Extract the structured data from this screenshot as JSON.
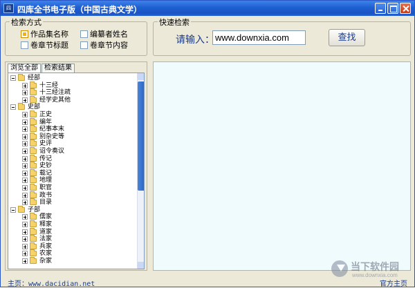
{
  "window": {
    "title": "四库全书电子版（中国古典文学）",
    "icon_name": "app-icon",
    "accent": "#2359d0"
  },
  "search_mode": {
    "legend": "检索方式",
    "options": [
      {
        "label": "作品集名称",
        "checked": true
      },
      {
        "label": "编纂者姓名",
        "checked": false
      },
      {
        "label": "卷章节标题",
        "checked": false
      },
      {
        "label": "卷章节内容",
        "checked": false
      }
    ]
  },
  "quick_search": {
    "legend": "快速检索",
    "label": "请输入：",
    "value": "www.downxia.com",
    "button": "查找"
  },
  "tabs": [
    {
      "label": "浏览全部",
      "active": true
    },
    {
      "label": "检索结果",
      "active": false
    }
  ],
  "tree": [
    {
      "label": "经部",
      "level": 0,
      "expanded": true
    },
    {
      "label": "十三经",
      "level": 1
    },
    {
      "label": "十三经注疏",
      "level": 1
    },
    {
      "label": "经学史其他",
      "level": 1
    },
    {
      "label": "史部",
      "level": 0,
      "expanded": true
    },
    {
      "label": "正史",
      "level": 1
    },
    {
      "label": "编年",
      "level": 1
    },
    {
      "label": "纪事本末",
      "level": 1
    },
    {
      "label": "别杂史等",
      "level": 1
    },
    {
      "label": "史评",
      "level": 1
    },
    {
      "label": "诏令奏议",
      "level": 1
    },
    {
      "label": "传记",
      "level": 1
    },
    {
      "label": "史钞",
      "level": 1
    },
    {
      "label": "载记",
      "level": 1
    },
    {
      "label": "地理",
      "level": 1
    },
    {
      "label": "职官",
      "level": 1
    },
    {
      "label": "政书",
      "level": 1
    },
    {
      "label": "目录",
      "level": 1
    },
    {
      "label": "子部",
      "level": 0,
      "expanded": true
    },
    {
      "label": "儒家",
      "level": 1
    },
    {
      "label": "释家",
      "level": 1
    },
    {
      "label": "道家",
      "level": 1
    },
    {
      "label": "法家",
      "level": 1
    },
    {
      "label": "兵家",
      "level": 1
    },
    {
      "label": "农家",
      "level": 1
    },
    {
      "label": "杂家",
      "level": 1
    }
  ],
  "status": {
    "left": "主页：www.dacidian.net",
    "right": "官方主页"
  },
  "watermark": {
    "line1": "当下软件园",
    "line2": "www.downxia.com"
  }
}
